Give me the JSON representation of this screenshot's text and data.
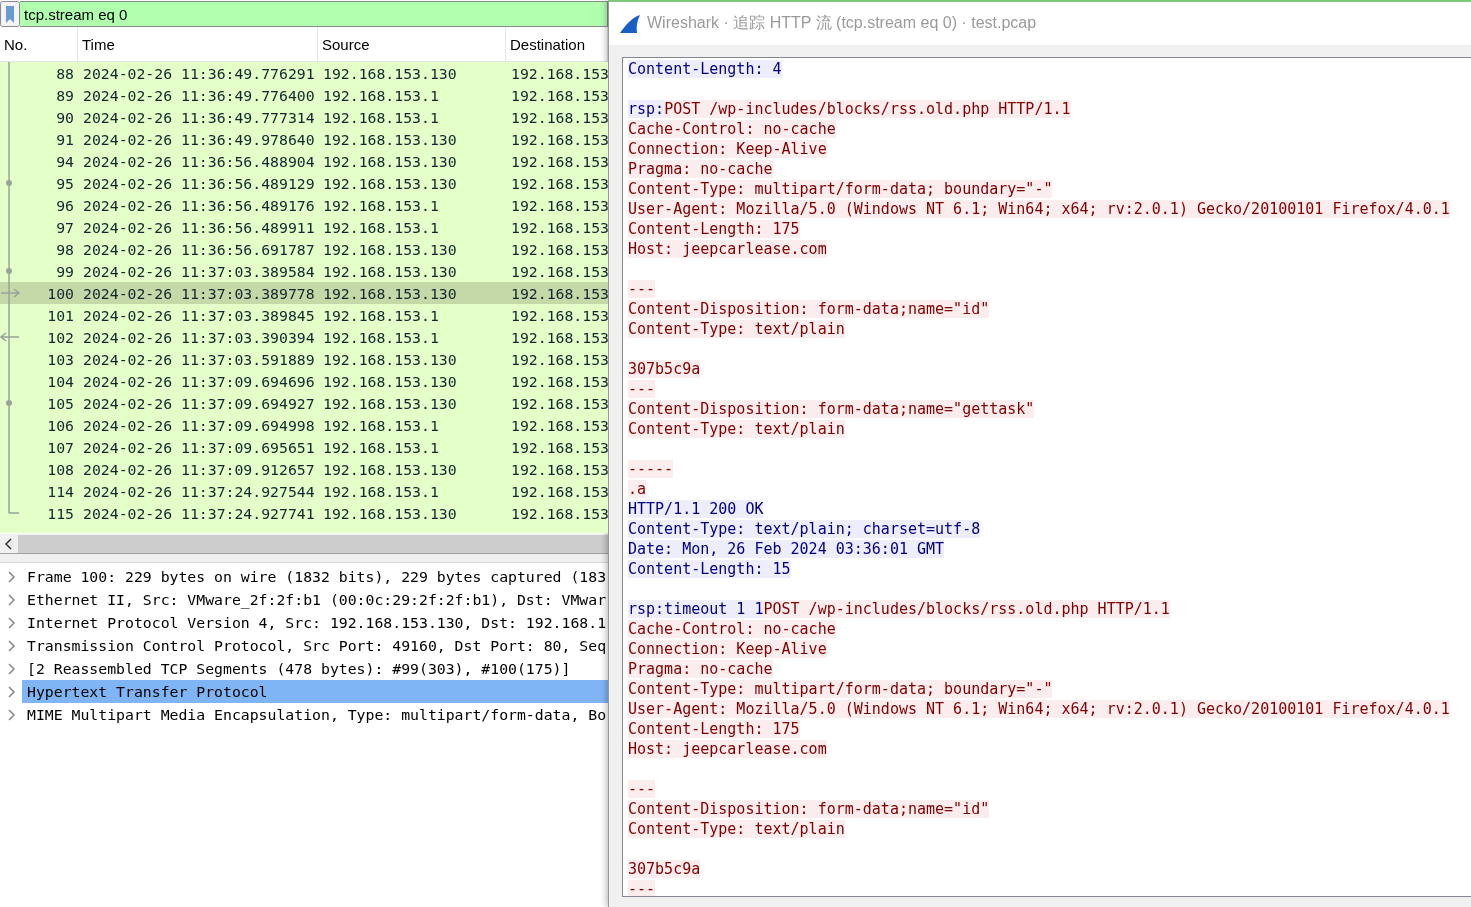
{
  "filter": {
    "value": "tcp.stream eq 0"
  },
  "packet_list": {
    "columns": [
      "No.",
      "Time",
      "Source",
      "Destination"
    ],
    "rows": [
      {
        "no": "88",
        "time": "2024-02-26 11:36:49.776291",
        "source": "192.168.153.130",
        "destination": "192.168.153",
        "selected": false,
        "kind": "start"
      },
      {
        "no": "89",
        "time": "2024-02-26 11:36:49.776400",
        "source": "192.168.153.1",
        "destination": "192.168.153",
        "selected": false,
        "kind": "line"
      },
      {
        "no": "90",
        "time": "2024-02-26 11:36:49.777314",
        "source": "192.168.153.1",
        "destination": "192.168.153",
        "selected": false,
        "kind": "line"
      },
      {
        "no": "91",
        "time": "2024-02-26 11:36:49.978640",
        "source": "192.168.153.130",
        "destination": "192.168.153",
        "selected": false,
        "kind": "line"
      },
      {
        "no": "94",
        "time": "2024-02-26 11:36:56.488904",
        "source": "192.168.153.130",
        "destination": "192.168.153",
        "selected": false,
        "kind": "line"
      },
      {
        "no": "95",
        "time": "2024-02-26 11:36:56.489129",
        "source": "192.168.153.130",
        "destination": "192.168.153",
        "selected": false,
        "kind": "dot"
      },
      {
        "no": "96",
        "time": "2024-02-26 11:36:56.489176",
        "source": "192.168.153.1",
        "destination": "192.168.153",
        "selected": false,
        "kind": "line"
      },
      {
        "no": "97",
        "time": "2024-02-26 11:36:56.489911",
        "source": "192.168.153.1",
        "destination": "192.168.153",
        "selected": false,
        "kind": "line"
      },
      {
        "no": "98",
        "time": "2024-02-26 11:36:56.691787",
        "source": "192.168.153.130",
        "destination": "192.168.153",
        "selected": false,
        "kind": "line"
      },
      {
        "no": "99",
        "time": "2024-02-26 11:37:03.389584",
        "source": "192.168.153.130",
        "destination": "192.168.153",
        "selected": false,
        "kind": "dot"
      },
      {
        "no": "100",
        "time": "2024-02-26 11:37:03.389778",
        "source": "192.168.153.130",
        "destination": "192.168.153",
        "selected": true,
        "kind": "arrow-right"
      },
      {
        "no": "101",
        "time": "2024-02-26 11:37:03.389845",
        "source": "192.168.153.1",
        "destination": "192.168.153",
        "selected": false,
        "kind": "line"
      },
      {
        "no": "102",
        "time": "2024-02-26 11:37:03.390394",
        "source": "192.168.153.1",
        "destination": "192.168.153",
        "selected": false,
        "kind": "arrow-left"
      },
      {
        "no": "103",
        "time": "2024-02-26 11:37:03.591889",
        "source": "192.168.153.130",
        "destination": "192.168.153",
        "selected": false,
        "kind": "line"
      },
      {
        "no": "104",
        "time": "2024-02-26 11:37:09.694696",
        "source": "192.168.153.130",
        "destination": "192.168.153",
        "selected": false,
        "kind": "line"
      },
      {
        "no": "105",
        "time": "2024-02-26 11:37:09.694927",
        "source": "192.168.153.130",
        "destination": "192.168.153",
        "selected": false,
        "kind": "dot"
      },
      {
        "no": "106",
        "time": "2024-02-26 11:37:09.694998",
        "source": "192.168.153.1",
        "destination": "192.168.153",
        "selected": false,
        "kind": "line"
      },
      {
        "no": "107",
        "time": "2024-02-26 11:37:09.695651",
        "source": "192.168.153.1",
        "destination": "192.168.153",
        "selected": false,
        "kind": "line"
      },
      {
        "no": "108",
        "time": "2024-02-26 11:37:09.912657",
        "source": "192.168.153.130",
        "destination": "192.168.153",
        "selected": false,
        "kind": "line"
      },
      {
        "no": "114",
        "time": "2024-02-26 11:37:24.927544",
        "source": "192.168.153.1",
        "destination": "192.168.153",
        "selected": false,
        "kind": "line"
      },
      {
        "no": "115",
        "time": "2024-02-26 11:37:24.927741",
        "source": "192.168.153.130",
        "destination": "192.168.153",
        "selected": false,
        "kind": "end"
      }
    ]
  },
  "details": [
    {
      "text": "Frame 100: 229 bytes on wire (1832 bits), 229 bytes captured (183",
      "expanded": false,
      "selected": false
    },
    {
      "text": "Ethernet II, Src: VMware_2f:2f:b1 (00:0c:29:2f:2f:b1), Dst: VMwar",
      "expanded": false,
      "selected": false
    },
    {
      "text": "Internet Protocol Version 4, Src: 192.168.153.130, Dst: 192.168.1",
      "expanded": false,
      "selected": false
    },
    {
      "text": "Transmission Control Protocol, Src Port: 49160, Dst Port: 80, Seq",
      "expanded": false,
      "selected": false
    },
    {
      "text": "[2 Reassembled TCP Segments (478 bytes): #99(303), #100(175)]",
      "expanded": false,
      "selected": false
    },
    {
      "text": "Hypertext Transfer Protocol",
      "expanded": false,
      "selected": true
    },
    {
      "text": "MIME Multipart Media Encapsulation, Type: multipart/form-data, Bo",
      "expanded": false,
      "selected": false
    }
  ],
  "stream_window": {
    "title": "Wireshark · 追踪 HTTP 流 (tcp.stream eq 0) · test.pcap",
    "lines": [
      {
        "kind": "text",
        "segments": [
          {
            "text": "Content-Length: 4",
            "kind": "server"
          }
        ]
      },
      {
        "kind": "blank"
      },
      {
        "kind": "text",
        "segments": [
          {
            "text": "rsp:",
            "kind": "server"
          },
          {
            "text": "POST /wp-includes/blocks/rss.old.php HTTP/1.1",
            "kind": "client"
          }
        ]
      },
      {
        "kind": "text",
        "segments": [
          {
            "text": "Cache-Control: no-cache",
            "kind": "client"
          }
        ]
      },
      {
        "kind": "text",
        "segments": [
          {
            "text": "Connection: Keep-Alive",
            "kind": "client"
          }
        ]
      },
      {
        "kind": "text",
        "segments": [
          {
            "text": "Pragma: no-cache",
            "kind": "client"
          }
        ]
      },
      {
        "kind": "text",
        "segments": [
          {
            "text": "Content-Type: multipart/form-data; boundary=\"-\"",
            "kind": "client"
          }
        ]
      },
      {
        "kind": "text",
        "segments": [
          {
            "text": "User-Agent: Mozilla/5.0 (Windows NT 6.1; Win64; x64; rv:2.0.1) Gecko/20100101 Firefox/4.0.1",
            "kind": "client"
          }
        ]
      },
      {
        "kind": "text",
        "segments": [
          {
            "text": "Content-Length: 175",
            "kind": "client"
          }
        ]
      },
      {
        "kind": "text",
        "segments": [
          {
            "text": "Host: jeepcarlease.com",
            "kind": "client"
          }
        ]
      },
      {
        "kind": "blank"
      },
      {
        "kind": "text",
        "segments": [
          {
            "text": "---",
            "kind": "client"
          }
        ]
      },
      {
        "kind": "text",
        "segments": [
          {
            "text": "Content-Disposition: form-data;name=\"id\"",
            "kind": "client"
          }
        ]
      },
      {
        "kind": "text",
        "segments": [
          {
            "text": "Content-Type: text/plain",
            "kind": "client"
          }
        ]
      },
      {
        "kind": "blank"
      },
      {
        "kind": "text",
        "segments": [
          {
            "text": "307b5c9a",
            "kind": "client"
          }
        ]
      },
      {
        "kind": "text",
        "segments": [
          {
            "text": "---",
            "kind": "client"
          }
        ]
      },
      {
        "kind": "text",
        "segments": [
          {
            "text": "Content-Disposition: form-data;name=\"gettask\"",
            "kind": "client"
          }
        ]
      },
      {
        "kind": "text",
        "segments": [
          {
            "text": "Content-Type: text/plain",
            "kind": "client"
          }
        ]
      },
      {
        "kind": "blank"
      },
      {
        "kind": "text",
        "segments": [
          {
            "text": "-----",
            "kind": "client"
          }
        ]
      },
      {
        "kind": "text",
        "segments": [
          {
            "text": ".a",
            "kind": "client"
          }
        ]
      },
      {
        "kind": "text",
        "segments": [
          {
            "text": "HTTP/1.1 200 OK",
            "kind": "server"
          }
        ]
      },
      {
        "kind": "text",
        "segments": [
          {
            "text": "Content-Type: text/plain; charset=utf-8",
            "kind": "server"
          }
        ]
      },
      {
        "kind": "text",
        "segments": [
          {
            "text": "Date: Mon, 26 Feb 2024 03:36:01 GMT",
            "kind": "server"
          }
        ]
      },
      {
        "kind": "text",
        "segments": [
          {
            "text": "Content-Length: 15",
            "kind": "server"
          }
        ]
      },
      {
        "kind": "blank"
      },
      {
        "kind": "text",
        "segments": [
          {
            "text": "rsp:timeout 1 1",
            "kind": "server"
          },
          {
            "text": "POST /wp-includes/blocks/rss.old.php HTTP/1.1",
            "kind": "client"
          }
        ]
      },
      {
        "kind": "text",
        "segments": [
          {
            "text": "Cache-Control: no-cache",
            "kind": "client"
          }
        ]
      },
      {
        "kind": "text",
        "segments": [
          {
            "text": "Connection: Keep-Alive",
            "kind": "client"
          }
        ]
      },
      {
        "kind": "text",
        "segments": [
          {
            "text": "Pragma: no-cache",
            "kind": "client"
          }
        ]
      },
      {
        "kind": "text",
        "segments": [
          {
            "text": "Content-Type: multipart/form-data; boundary=\"-\"",
            "kind": "client"
          }
        ]
      },
      {
        "kind": "text",
        "segments": [
          {
            "text": "User-Agent: Mozilla/5.0 (Windows NT 6.1; Win64; x64; rv:2.0.1) Gecko/20100101 Firefox/4.0.1",
            "kind": "client"
          }
        ]
      },
      {
        "kind": "text",
        "segments": [
          {
            "text": "Content-Length: 175",
            "kind": "client"
          }
        ]
      },
      {
        "kind": "text",
        "segments": [
          {
            "text": "Host: jeepcarlease.com",
            "kind": "client"
          }
        ]
      },
      {
        "kind": "blank"
      },
      {
        "kind": "text",
        "segments": [
          {
            "text": "---",
            "kind": "client"
          }
        ]
      },
      {
        "kind": "text",
        "segments": [
          {
            "text": "Content-Disposition: form-data;name=\"id\"",
            "kind": "client"
          }
        ]
      },
      {
        "kind": "text",
        "segments": [
          {
            "text": "Content-Type: text/plain",
            "kind": "client"
          }
        ]
      },
      {
        "kind": "blank"
      },
      {
        "kind": "text",
        "segments": [
          {
            "text": "307b5c9a",
            "kind": "client"
          }
        ]
      },
      {
        "kind": "text",
        "segments": [
          {
            "text": "---",
            "kind": "client"
          }
        ]
      }
    ]
  }
}
